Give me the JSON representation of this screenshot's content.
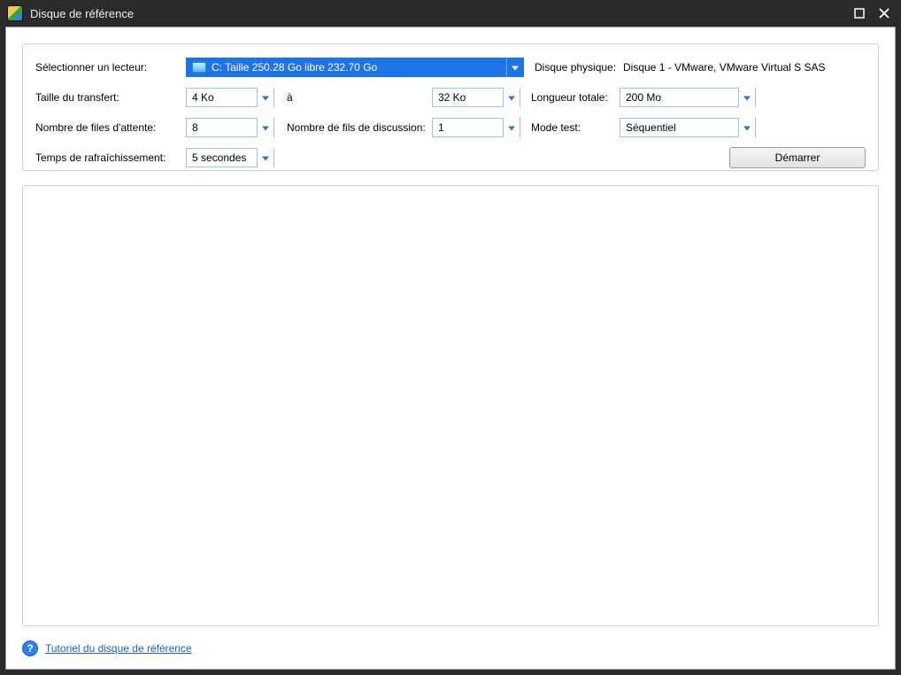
{
  "window": {
    "title": "Disque de référence"
  },
  "labels": {
    "select_drive": "Sélectionner un lecteur:",
    "physical_disk": "Disque physique:",
    "transfer_size": "Taille du transfert:",
    "to": "à",
    "total_length": "Longueur totale:",
    "queues": "Nombre de files d'attente:",
    "threads": "Nombre de fils de discussion:",
    "test_mode": "Mode test:",
    "refresh": "Temps de rafraîchissement:"
  },
  "values": {
    "drive": "C:  Taille 250.28 Go  libre 232.70 Go",
    "physical_disk": "Disque 1 - VMware, VMware Virtual S SAS",
    "transfer_from": "4 Ko",
    "transfer_to": "32 Ko",
    "total_length": "200 Mo",
    "queues": "8",
    "threads": "1",
    "test_mode": "Séquentiel",
    "refresh": "5 secondes"
  },
  "buttons": {
    "start": "Démarrer"
  },
  "footer": {
    "tutorial_link": "Tutoriel du disque de référence"
  }
}
